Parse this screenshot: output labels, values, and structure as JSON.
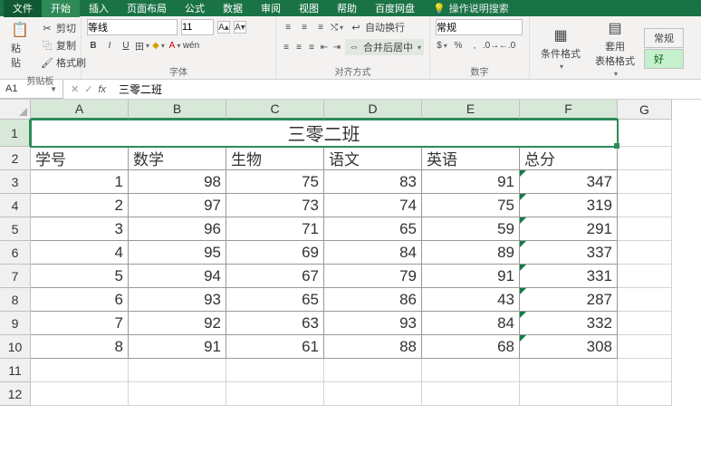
{
  "tabs": {
    "file": "文件",
    "items": [
      "开始",
      "插入",
      "页面布局",
      "公式",
      "数据",
      "审阅",
      "视图",
      "帮助",
      "百度网盘"
    ],
    "active": "开始",
    "search_placeholder": "操作说明搜索"
  },
  "ribbon": {
    "clipboard": {
      "paste": "粘贴",
      "cut": "剪切",
      "copy": "复制",
      "format_painter": "格式刷",
      "group": "剪贴板"
    },
    "font": {
      "name": "等线",
      "size": "11",
      "bold": "B",
      "italic": "I",
      "underline": "U",
      "group": "字体"
    },
    "align": {
      "wrap": "自动换行",
      "merge": "合并后居中",
      "group": "对齐方式"
    },
    "number": {
      "format": "常规",
      "group": "数字"
    },
    "styles": {
      "cond": "条件格式",
      "table": "套用\n表格格式",
      "good": "好",
      "normal": "常规"
    }
  },
  "formula_bar": {
    "name_box": "A1",
    "value": "三零二班"
  },
  "grid": {
    "columns": [
      "A",
      "B",
      "C",
      "D",
      "E",
      "F",
      "G"
    ],
    "title": "三零二班",
    "headers": [
      "学号",
      "数学",
      "生物",
      "语文",
      "英语",
      "总分"
    ],
    "rows": [
      [
        1,
        98,
        75,
        83,
        91,
        347
      ],
      [
        2,
        97,
        73,
        74,
        75,
        319
      ],
      [
        3,
        96,
        71,
        65,
        59,
        291
      ],
      [
        4,
        95,
        69,
        84,
        89,
        337
      ],
      [
        5,
        94,
        67,
        79,
        91,
        331
      ],
      [
        6,
        93,
        65,
        86,
        43,
        287
      ],
      [
        7,
        92,
        63,
        93,
        84,
        332
      ],
      [
        8,
        91,
        61,
        88,
        68,
        308
      ]
    ],
    "blank_rows": 2
  },
  "chart_data": {
    "type": "table",
    "title": "三零二班",
    "columns": [
      "学号",
      "数学",
      "生物",
      "语文",
      "英语",
      "总分"
    ],
    "rows": [
      [
        1,
        98,
        75,
        83,
        91,
        347
      ],
      [
        2,
        97,
        73,
        74,
        75,
        319
      ],
      [
        3,
        96,
        71,
        65,
        59,
        291
      ],
      [
        4,
        95,
        69,
        84,
        89,
        337
      ],
      [
        5,
        94,
        67,
        79,
        91,
        331
      ],
      [
        6,
        93,
        65,
        86,
        43,
        287
      ],
      [
        7,
        92,
        63,
        93,
        84,
        332
      ],
      [
        8,
        91,
        61,
        88,
        68,
        308
      ]
    ]
  }
}
